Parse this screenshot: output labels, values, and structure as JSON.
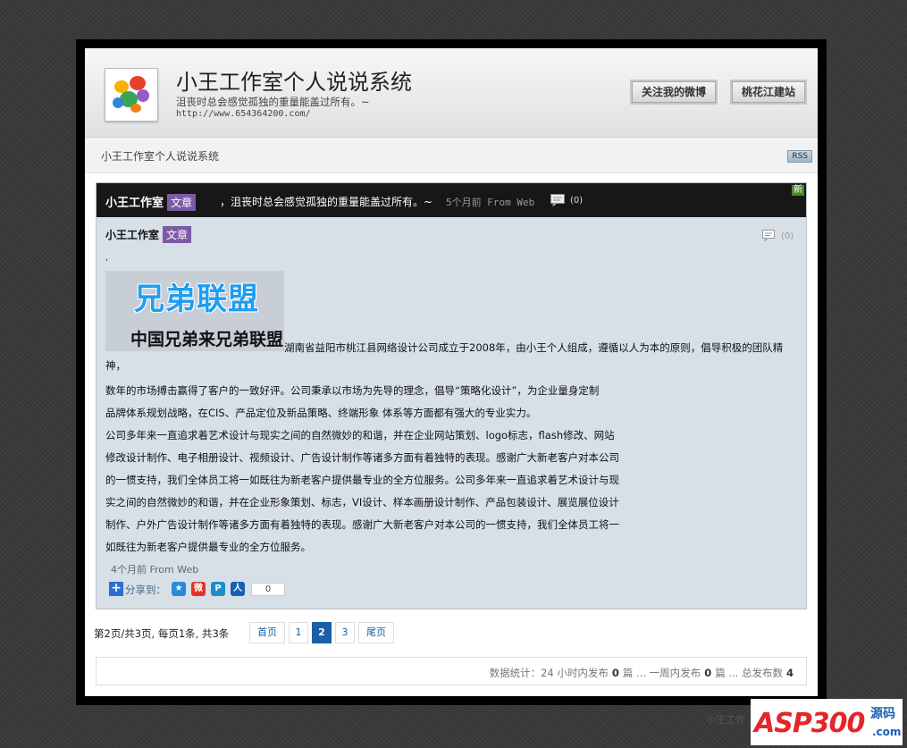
{
  "header": {
    "title": "小王工作室个人说说系统",
    "description": "沮丧时总会感觉孤独的重量能盖过所有。~",
    "url": "http://www.654364200.com/",
    "buttons": [
      "关注我的微博",
      "桃花江建站"
    ]
  },
  "subbar": {
    "title": "小王工作室个人说说系统",
    "rss": "RSS"
  },
  "post": {
    "author": "小王工作室",
    "tag": "文章",
    "text": "，沮丧时总会感觉孤独的重量能盖过所有。~",
    "time_source": "5个月前 From Web",
    "comment_count": "(0)",
    "new_badge": "新",
    "body_comment_count": "(0)",
    "dot": ",",
    "banner_line1": "兄弟联盟",
    "banner_line2": "中国兄弟来兄弟联盟",
    "paragraph1": "湖南省益阳市桃江县网络设计公司成立于2008年，由小王个人组成，遵循以人为本的原则，倡导积极的团队精神，",
    "lines": [
      "数年的市场搏击赢得了客户的一致好评。公司秉承以市场为先导的理念，倡导“策略化设计”，为企业量身定制",
      "品牌体系规划战略，在CIS、产品定位及新品策略、终端形象 体系等方面都有强大的专业实力。",
      "公司多年来一直追求着艺术设计与现实之间的自然微妙的和谐，并在企业网站策划、logo标志，flash修改、网站",
      "修改设计制作、电子相册设计、视频设计、广告设计制作等诸多方面有着独特的表现。感谢广大新老客户对本公司",
      "的一惯支持，我们全体员工将一如既往为新老客户提供最专业的全方位服务。公司多年来一直追求着艺术设计与现",
      "实之间的自然微妙的和谐，并在企业形象策划、标志，VI设计、样本画册设计制作、产品包装设计、展览展位设计",
      "制作、户外广告设计制作等诸多方面有着独特的表现。感谢广大新老客户对本公司的一惯支持，我们全体员工将一",
      "如既往为新老客户提供最专业的全方位服务。"
    ],
    "meta": "4个月前   From Web",
    "share_label": "分享到：",
    "share_count": "0"
  },
  "pager": {
    "info": "第2页/共3页, 每页1条, 共3条",
    "first": "首页",
    "pages": [
      "1",
      "2",
      "3"
    ],
    "last": "尾页"
  },
  "stats": {
    "label": "数据统计：24 小时内发布",
    "day_count": "0",
    "sep1": "篇 ... 一周内发布",
    "week_count": "0",
    "sep2": "篇 ... 总发布数",
    "total": "4"
  },
  "footer_text": "小王工作",
  "watermark": {
    "main": "ASP300",
    "side": "源码",
    "domain": ".com"
  },
  "colors": {
    "accent": "#1b5fa6",
    "tag": "#7b5aa6",
    "post_bg": "#d7dfe7"
  }
}
